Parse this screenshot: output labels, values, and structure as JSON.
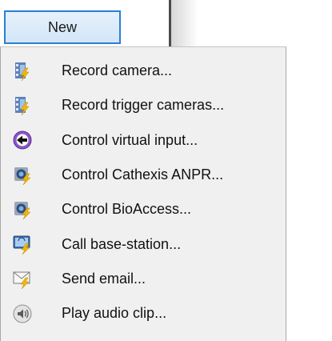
{
  "toolbar": {
    "new_label": "New"
  },
  "menu": {
    "items": [
      {
        "label": "Record camera...",
        "icon": "record-camera-icon"
      },
      {
        "label": "Record trigger cameras...",
        "icon": "record-trigger-cameras-icon"
      },
      {
        "label": "Control virtual input...",
        "icon": "virtual-input-icon"
      },
      {
        "label": "Control Cathexis ANPR...",
        "icon": "cathexis-anpr-icon"
      },
      {
        "label": "Control BioAccess...",
        "icon": "bioaccess-icon"
      },
      {
        "label": "Call base-station...",
        "icon": "base-station-icon"
      },
      {
        "label": "Send email...",
        "icon": "email-icon"
      },
      {
        "label": "Play audio clip...",
        "icon": "audio-icon"
      }
    ]
  },
  "colors": {
    "accent": "#2b7fd1",
    "menu_background": "#f0f0f0",
    "lightning": "#f2b705"
  }
}
